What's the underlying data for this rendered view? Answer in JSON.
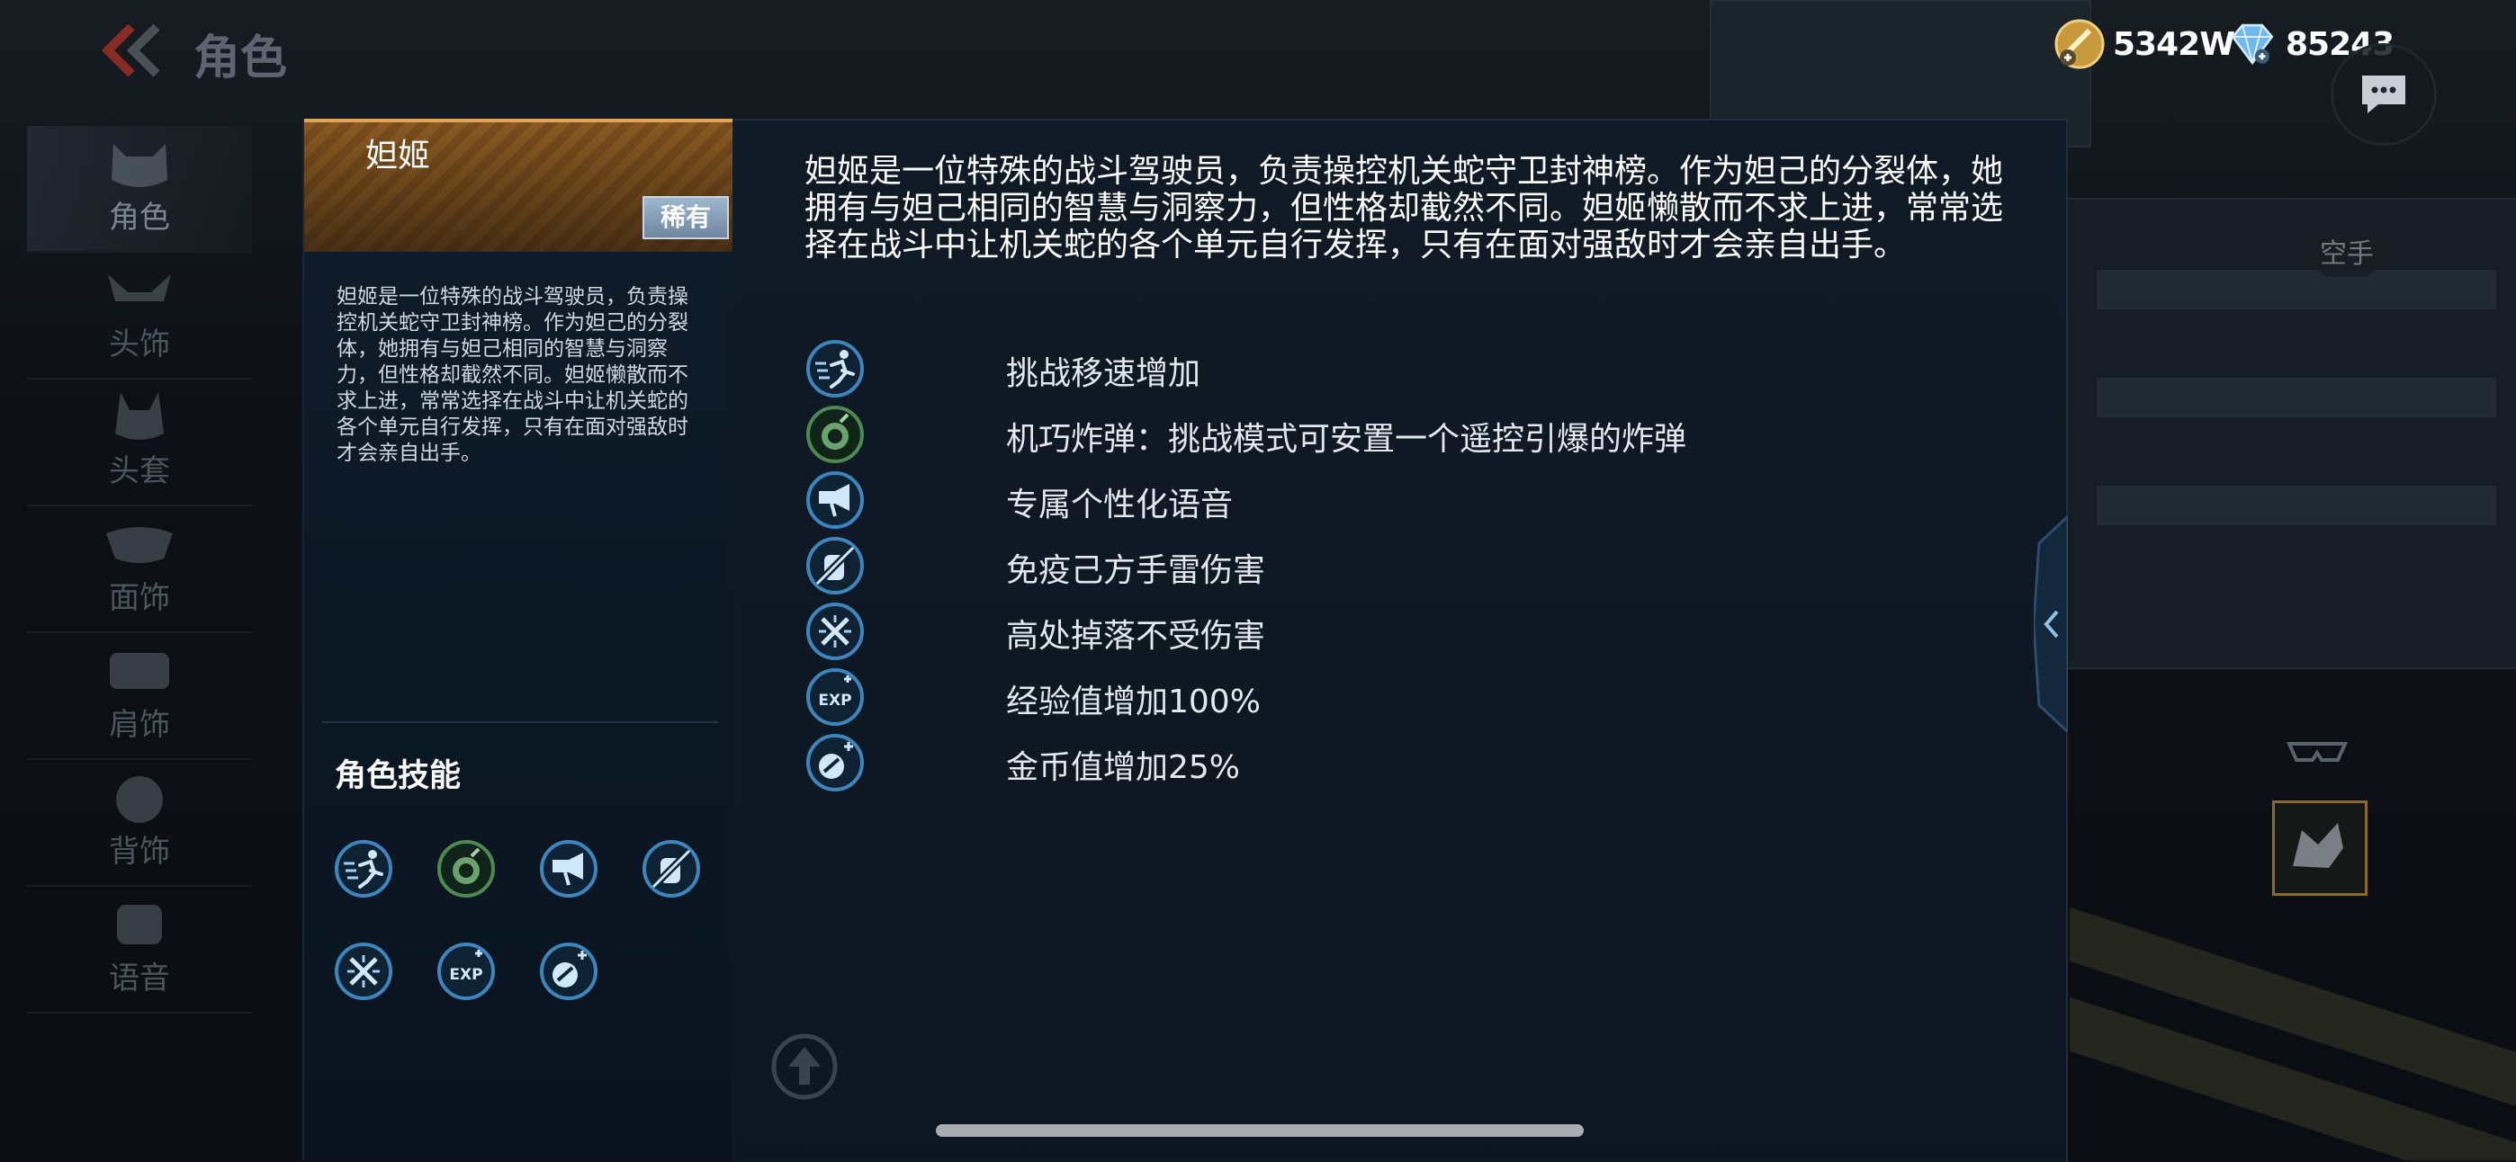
{
  "header": {
    "title": "角色",
    "gold": "5342W",
    "diamonds": "85243"
  },
  "nav": {
    "items": [
      {
        "label": "角色",
        "icon": "cat-face-icon"
      },
      {
        "label": "头饰",
        "icon": "headwear-icon"
      },
      {
        "label": "头套",
        "icon": "head-cover-icon"
      },
      {
        "label": "面饰",
        "icon": "mask-icon"
      },
      {
        "label": "肩饰",
        "icon": "shoulder-icon"
      },
      {
        "label": "背饰",
        "icon": "back-accessory-icon"
      },
      {
        "label": "语音",
        "icon": "voice-icon"
      }
    ]
  },
  "right_side": {
    "empty_hand": "空手"
  },
  "character": {
    "name": "妲姬",
    "rarity": "稀有",
    "description": "妲姬是一位特殊的战斗驾驶员，负责操控机关蛇守卫封神榜。作为妲己的分裂体，她拥有与妲己相同的智慧与洞察力，但性格却截然不同。妲姬懒散而不求上进，常常选择在战斗中让机关蛇的各个单元自行发挥，只有在面对强敌时才会亲自出手。",
    "skills_title": "角色技能",
    "features": [
      {
        "text": "挑战移速增加",
        "icon": "running-icon"
      },
      {
        "text": "机巧炸弹：挑战模式可安置一个遥控引爆的炸弹",
        "icon": "bomb-icon"
      },
      {
        "text": "专属个性化语音",
        "icon": "voice-horn-icon"
      },
      {
        "text": "免疫己方手雷伤害",
        "icon": "grenade-immune-icon"
      },
      {
        "text": "高处掉落不受伤害",
        "icon": "fall-immune-icon"
      },
      {
        "text": "经验值增加100%",
        "icon": "exp-boost-icon"
      },
      {
        "text": "金币值增加25%",
        "icon": "coin-boost-icon"
      }
    ]
  },
  "colors": {
    "accent_gold": "#e3a64a",
    "icon_blue": "#2f6f9e",
    "icon_green": "#4d8a52"
  }
}
